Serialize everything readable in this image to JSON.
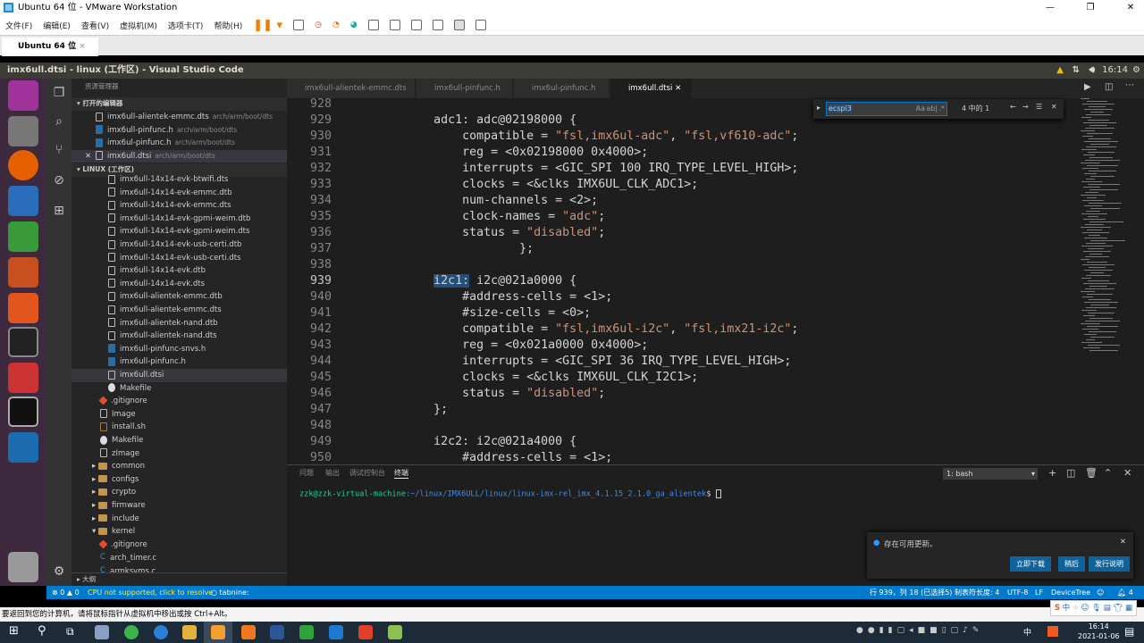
{
  "vmware": {
    "title": "Ubuntu 64 位 - VMware Workstation",
    "menu": [
      "文件(F)",
      "编辑(E)",
      "查看(V)",
      "虚拟机(M)",
      "选项卡(T)",
      "帮助(H)"
    ],
    "tab": "Ubuntu 64 位",
    "status_hint": "要返回到您的计算机，请将鼠标指针从虚拟机中移出或按 Ctrl+Alt。"
  },
  "ubuntu": {
    "window_title": "imx6ull.dtsi - linux (工作区) - Visual Studio Code",
    "clock": "16:14"
  },
  "sidebar": {
    "title": "资源管理器",
    "open_editors_label": "打开的编辑器",
    "workspace_label": "LINUX (工作区)",
    "outline_label": "大纲",
    "open_editors": [
      {
        "name": "imx6ull-alientek-emmc.dts",
        "path": "arch/arm/boot/dts",
        "icon": "file"
      },
      {
        "name": "imx6ull-pinfunc.h",
        "path": "arch/arm/boot/dts",
        "icon": "h"
      },
      {
        "name": "imx6ul-pinfunc.h",
        "path": "arch/arm/boot/dts",
        "icon": "h"
      },
      {
        "name": "imx6ull.dtsi",
        "path": "arch/arm/boot/dts",
        "icon": "file",
        "active": true
      }
    ],
    "tree": [
      {
        "name": "imx6ull-14x14-evk-btwifi.dts",
        "indent": 3,
        "icon": "file"
      },
      {
        "name": "imx6ull-14x14-evk-emmc.dtb",
        "indent": 3,
        "icon": "file"
      },
      {
        "name": "imx6ull-14x14-evk-emmc.dts",
        "indent": 3,
        "icon": "file"
      },
      {
        "name": "imx6ull-14x14-evk-gpmi-weim.dtb",
        "indent": 3,
        "icon": "file"
      },
      {
        "name": "imx6ull-14x14-evk-gpmi-weim.dts",
        "indent": 3,
        "icon": "file"
      },
      {
        "name": "imx6ull-14x14-evk-usb-certi.dtb",
        "indent": 3,
        "icon": "file"
      },
      {
        "name": "imx6ull-14x14-evk-usb-certi.dts",
        "indent": 3,
        "icon": "file"
      },
      {
        "name": "imx6ull-14x14-evk.dtb",
        "indent": 3,
        "icon": "file"
      },
      {
        "name": "imx6ull-14x14-evk.dts",
        "indent": 3,
        "icon": "file"
      },
      {
        "name": "imx6ull-alientek-emmc.dtb",
        "indent": 3,
        "icon": "file"
      },
      {
        "name": "imx6ull-alientek-emmc.dts",
        "indent": 3,
        "icon": "file"
      },
      {
        "name": "imx6ull-alientek-nand.dtb",
        "indent": 3,
        "icon": "file"
      },
      {
        "name": "imx6ull-alientek-nand.dts",
        "indent": 3,
        "icon": "file"
      },
      {
        "name": "imx6ull-pinfunc-snvs.h",
        "indent": 3,
        "icon": "h"
      },
      {
        "name": "imx6ull-pinfunc.h",
        "indent": 3,
        "icon": "h"
      },
      {
        "name": "imx6ull.dtsi",
        "indent": 3,
        "icon": "file",
        "active": true
      },
      {
        "name": "Makefile",
        "indent": 3,
        "icon": "make"
      },
      {
        "name": ".gitignore",
        "indent": 2,
        "icon": "git"
      },
      {
        "name": "Image",
        "indent": 2,
        "icon": "file"
      },
      {
        "name": "install.sh",
        "indent": 2,
        "icon": "sh"
      },
      {
        "name": "Makefile",
        "indent": 2,
        "icon": "make"
      },
      {
        "name": "zImage",
        "indent": 2,
        "icon": "file"
      },
      {
        "name": "common",
        "indent": 1,
        "icon": "folder",
        "arrow": "▸"
      },
      {
        "name": "configs",
        "indent": 1,
        "icon": "folder",
        "arrow": "▸"
      },
      {
        "name": "crypto",
        "indent": 1,
        "icon": "folder",
        "arrow": "▸"
      },
      {
        "name": "firmware",
        "indent": 1,
        "icon": "folder",
        "arrow": "▸"
      },
      {
        "name": "include",
        "indent": 1,
        "icon": "folder",
        "arrow": "▸"
      },
      {
        "name": "kernel",
        "indent": 1,
        "icon": "folder",
        "arrow": "▾"
      },
      {
        "name": ".gitignore",
        "indent": 2,
        "icon": "git"
      },
      {
        "name": "arch_timer.c",
        "indent": 2,
        "icon": "c"
      },
      {
        "name": "armksyms.c",
        "indent": 2,
        "icon": "c"
      }
    ]
  },
  "tabs": [
    {
      "label": "imx6ull-alientek-emmc.dts"
    },
    {
      "label": "imx6ull-pinfunc.h"
    },
    {
      "label": "imx6ul-pinfunc.h"
    },
    {
      "label": "imx6ull.dtsi",
      "active": true
    }
  ],
  "find": {
    "query": "ecspi3",
    "result": "4 中的 1",
    "case": "Aa",
    "word": "ab|"
  },
  "code": [
    {
      "n": "928",
      "t": []
    },
    {
      "n": "929",
      "t": [
        [
          "            adc1: adc@02198000 {",
          ""
        ]
      ]
    },
    {
      "n": "930",
      "t": [
        [
          "                compatible = ",
          ""
        ],
        [
          "\"fsl,imx6ul-adc\"",
          "s"
        ],
        [
          ", ",
          ""
        ],
        [
          "\"fsl,vf610-adc\"",
          "s"
        ],
        [
          ";",
          ""
        ]
      ]
    },
    {
      "n": "931",
      "t": [
        [
          "                reg = <0x02198000 0x4000>;",
          ""
        ]
      ]
    },
    {
      "n": "932",
      "t": [
        [
          "                interrupts = <GIC_SPI 100 IRQ_TYPE_LEVEL_HIGH>;",
          ""
        ]
      ]
    },
    {
      "n": "933",
      "t": [
        [
          "                clocks = <&clks IMX6UL_CLK_ADC1>;",
          ""
        ]
      ]
    },
    {
      "n": "934",
      "t": [
        [
          "                num-channels = <2>;",
          ""
        ]
      ]
    },
    {
      "n": "935",
      "t": [
        [
          "                clock-names = ",
          ""
        ],
        [
          "\"adc\"",
          "s"
        ],
        [
          ";",
          ""
        ]
      ]
    },
    {
      "n": "936",
      "t": [
        [
          "                status = ",
          ""
        ],
        [
          "\"disabled\"",
          "s"
        ],
        [
          ";",
          ""
        ]
      ]
    },
    {
      "n": "937",
      "t": [
        [
          "                        };",
          ""
        ]
      ]
    },
    {
      "n": "938",
      "t": []
    },
    {
      "n": "939",
      "t": [
        [
          "            ",
          ""
        ],
        [
          "i2c1:",
          "sel"
        ],
        [
          " i2c@021a0000 {",
          ""
        ]
      ],
      "cur": true
    },
    {
      "n": "940",
      "t": [
        [
          "                #address-cells = <1>;",
          ""
        ]
      ]
    },
    {
      "n": "941",
      "t": [
        [
          "                #size-cells = <0>;",
          ""
        ]
      ]
    },
    {
      "n": "942",
      "t": [
        [
          "                compatible = ",
          ""
        ],
        [
          "\"fsl,imx6ul-i2c\"",
          "s"
        ],
        [
          ", ",
          ""
        ],
        [
          "\"fsl,imx21-i2c\"",
          "s"
        ],
        [
          ";",
          ""
        ]
      ]
    },
    {
      "n": "943",
      "t": [
        [
          "                reg = <0x021a0000 0x4000>;",
          ""
        ]
      ]
    },
    {
      "n": "944",
      "t": [
        [
          "                interrupts = <GIC_SPI 36 IRQ_TYPE_LEVEL_HIGH>;",
          ""
        ]
      ]
    },
    {
      "n": "945",
      "t": [
        [
          "                clocks = <&clks IMX6UL_CLK_I2C1>;",
          ""
        ]
      ]
    },
    {
      "n": "946",
      "t": [
        [
          "                status = ",
          ""
        ],
        [
          "\"disabled\"",
          "s"
        ],
        [
          ";",
          ""
        ]
      ]
    },
    {
      "n": "947",
      "t": [
        [
          "            };",
          ""
        ]
      ]
    },
    {
      "n": "948",
      "t": []
    },
    {
      "n": "949",
      "t": [
        [
          "            i2c2: i2c@021a4000 {",
          ""
        ]
      ]
    },
    {
      "n": "950",
      "t": [
        [
          "                #address-cells = <1>;",
          ""
        ]
      ]
    }
  ],
  "panel": {
    "tabs": [
      "问题",
      "输出",
      "调试控制台",
      "终端"
    ],
    "active_tab": 3,
    "terminal_select": "1: bash",
    "prompt_user": "zzk@zzk-virtual-machine",
    "prompt_path": ":~/linux/IMX6ULL/linux/linux-imx-rel_imx_4.1.15_2.1.0_ga_alientek",
    "prompt_end": "$ "
  },
  "notification": {
    "message": "存在可用更新。",
    "buttons": [
      "立即下载",
      "稍后",
      "发行说明"
    ]
  },
  "status": {
    "errors": "0",
    "warnings": "0",
    "cpu": "CPU not supported, click to resolve",
    "tabnine": "tabnine:",
    "position": "行 939，列 18 (已选择5)",
    "tab_size": "制表符长度: 4",
    "encoding": "UTF-8",
    "eol": "LF",
    "language": "DeviceTree",
    "bell_count": "4"
  },
  "taskbar": {
    "time": "16:14",
    "date": "2021-01-06",
    "ime": "中"
  }
}
